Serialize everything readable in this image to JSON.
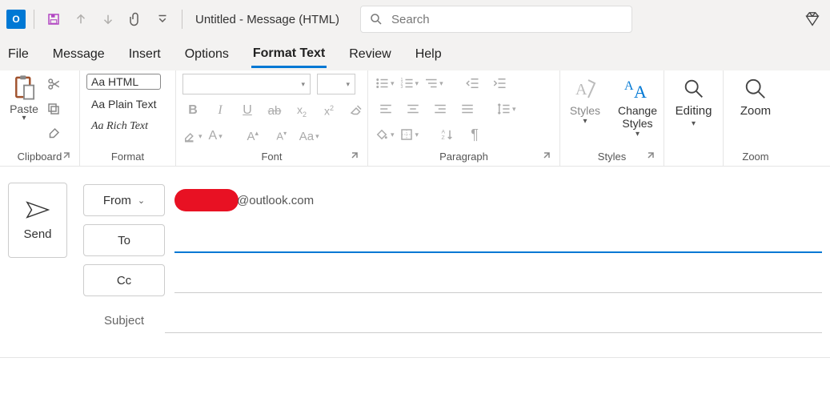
{
  "titlebar": {
    "app_abbrev": "O",
    "title": "Untitled - Message (HTML)",
    "search_placeholder": "Search"
  },
  "tabs": [
    "File",
    "Message",
    "Insert",
    "Options",
    "Format Text",
    "Review",
    "Help"
  ],
  "active_tab": "Format Text",
  "ribbon": {
    "clipboard": {
      "paste": "Paste",
      "group_label": "Clipboard"
    },
    "format": {
      "html": "Aa HTML",
      "plain": "Aa Plain Text",
      "rich": "Aa Rich Text",
      "selected": "html",
      "group_label": "Format"
    },
    "font": {
      "font_name": "",
      "font_size": "",
      "group_label": "Font"
    },
    "paragraph": {
      "group_label": "Paragraph"
    },
    "styles": {
      "styles_label": "Styles",
      "change_styles_label": "Change Styles",
      "group_label": "Styles"
    },
    "editing": {
      "label": "Editing"
    },
    "zoom": {
      "label": "Zoom",
      "group_label": "Zoom"
    }
  },
  "compose": {
    "send": "Send",
    "from_label": "From",
    "from_domain": "@outlook.com",
    "to_label": "To",
    "cc_label": "Cc",
    "subject_label": "Subject"
  }
}
